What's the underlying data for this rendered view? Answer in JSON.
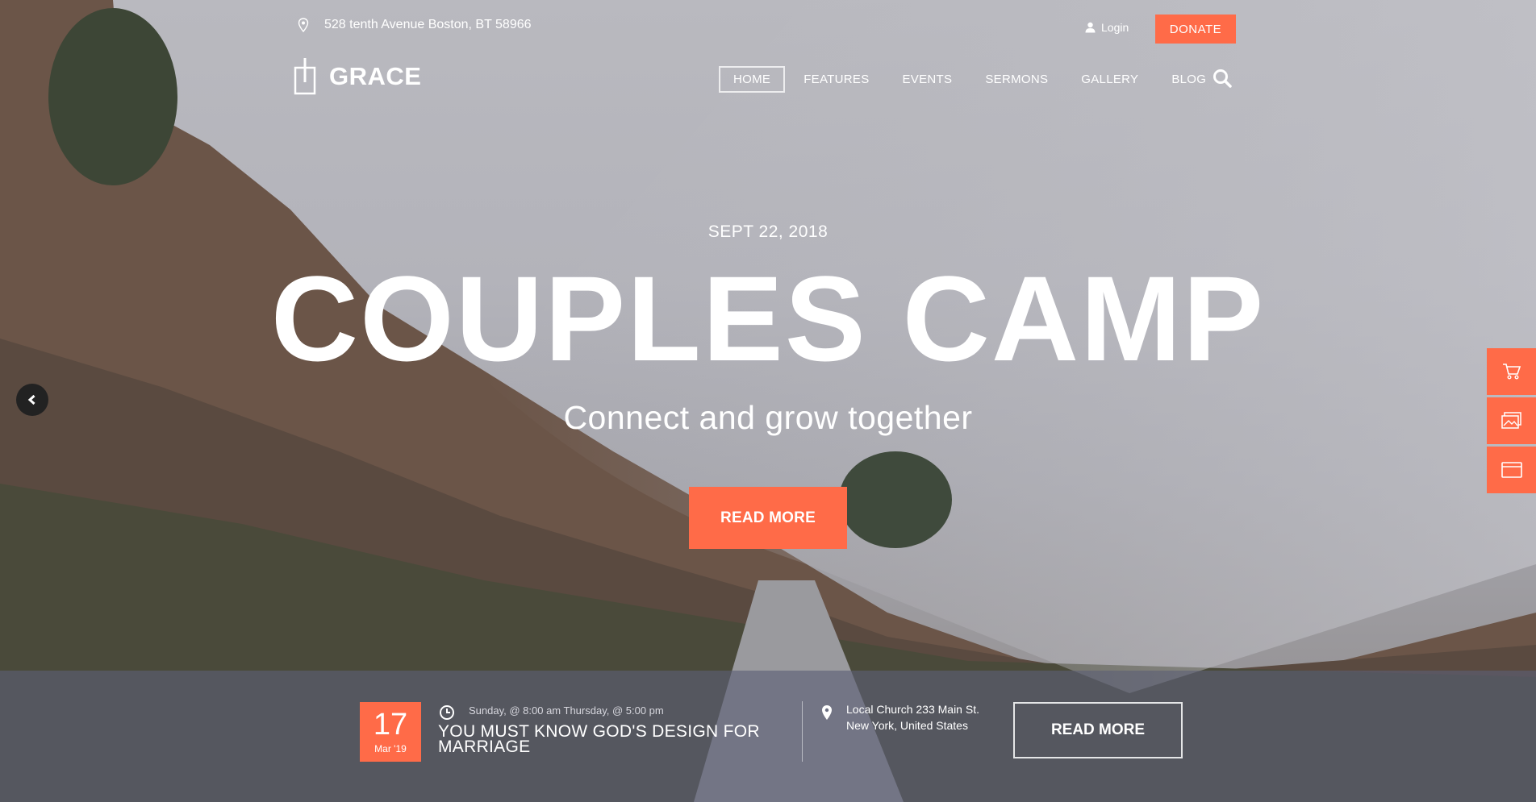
{
  "topbar": {
    "address": "528 tenth Avenue Boston, BT 58966",
    "login": "Login",
    "donate": "DONATE"
  },
  "logo": {
    "text": "GRACE"
  },
  "nav": {
    "items": [
      "HOME",
      "FEATURES",
      "EVENTS",
      "SERMONS",
      "GALLERY",
      "BLOG"
    ],
    "active": "HOME"
  },
  "hero": {
    "date": "SEPT 22, 2018",
    "title": "COUPLES CAMP",
    "subtitle": "Connect and grow together",
    "button": "READ MORE"
  },
  "event": {
    "day": "17",
    "month": "Mar '19",
    "time": "Sunday, @ 8:00 am Thursday, @ 5:00 pm",
    "title": "YOU MUST KNOW GOD'S DESIGN FOR MARRIAGE",
    "location_line1": "Local Church 233 Main St.",
    "location_line2": "New York, United States",
    "button": "READ MORE"
  },
  "side_tools": [
    "cart-icon",
    "gallery-icon",
    "card-icon"
  ],
  "colors": {
    "accent": "#ff6b48",
    "bar": "#5c6076"
  }
}
